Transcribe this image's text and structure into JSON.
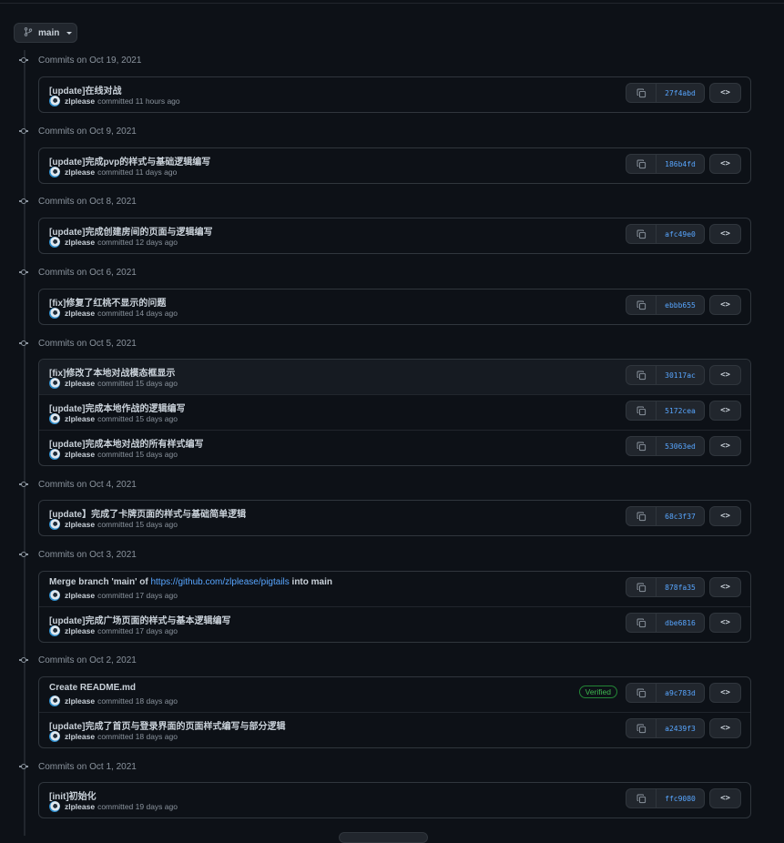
{
  "branch": {
    "label": "main",
    "icon": "git-branch-icon"
  },
  "groups": [
    {
      "date": "Commits on Oct 19, 2021",
      "commits": [
        {
          "message": "[update]在线对战",
          "author": "zlplease",
          "time": "committed 11 hours ago",
          "sha": "27f4abd"
        }
      ]
    },
    {
      "date": "Commits on Oct 9, 2021",
      "commits": [
        {
          "message": "[update]完成pvp的样式与基础逻辑编写",
          "author": "zlplease",
          "time": "committed 11 days ago",
          "sha": "186b4fd"
        }
      ]
    },
    {
      "date": "Commits on Oct 8, 2021",
      "commits": [
        {
          "message": "[update]完成创建房间的页面与逻辑编写",
          "author": "zlplease",
          "time": "committed 12 days ago",
          "sha": "afc49e0"
        }
      ]
    },
    {
      "date": "Commits on Oct 6, 2021",
      "commits": [
        {
          "message": "[fix]修复了红桃不显示的问题",
          "author": "zlplease",
          "time": "committed 14 days ago",
          "sha": "ebbb655"
        }
      ]
    },
    {
      "date": "Commits on Oct 5, 2021",
      "commits": [
        {
          "message": "[fix]修改了本地对战模态框显示",
          "author": "zlplease",
          "time": "committed 15 days ago",
          "sha": "30117ac",
          "highlighted": true
        },
        {
          "message": "[update]完成本地作战的逻辑编写",
          "author": "zlplease",
          "time": "committed 15 days ago",
          "sha": "5172cea"
        },
        {
          "message": "[update]完成本地对战的所有样式编写",
          "author": "zlplease",
          "time": "committed 15 days ago",
          "sha": "53063ed"
        }
      ]
    },
    {
      "date": "Commits on Oct 4, 2021",
      "commits": [
        {
          "message": "[update】完成了卡牌页面的样式与基础简单逻辑",
          "author": "zlplease",
          "time": "committed 15 days ago",
          "sha": "68c3f37"
        }
      ]
    },
    {
      "date": "Commits on Oct 3, 2021",
      "commits": [
        {
          "message": "Merge branch 'main' of ",
          "link": "https://github.com/zlplease/pigtails",
          "message_suffix": " into main",
          "author": "zlplease",
          "time": "committed 17 days ago",
          "sha": "878fa35"
        },
        {
          "message": "[update]完成广场页面的样式与基本逻辑编写",
          "author": "zlplease",
          "time": "committed 17 days ago",
          "sha": "dbe6816"
        }
      ]
    },
    {
      "date": "Commits on Oct 2, 2021",
      "commits": [
        {
          "message": "Create README.md",
          "author": "zlplease",
          "time": "committed 18 days ago",
          "sha": "a9c783d",
          "badge": "Verified"
        },
        {
          "message": "[update]完成了首页与登录界面的页面样式编写与部分逻辑",
          "author": "zlplease",
          "time": "committed 18 days ago",
          "sha": "a2439f3"
        }
      ]
    },
    {
      "date": "Commits on Oct 1, 2021",
      "commits": [
        {
          "message": "[init]初始化",
          "author": "zlplease",
          "time": "committed 19 days ago",
          "sha": "ffc9080"
        }
      ]
    }
  ],
  "icons": {
    "copy": "copy-icon",
    "browse": "code-browse-icon",
    "commit": "git-commit-icon"
  },
  "colors": {
    "background": "#0d1117",
    "link": "#58a6ff",
    "verified": "#3fb950",
    "border": "#30363d"
  }
}
